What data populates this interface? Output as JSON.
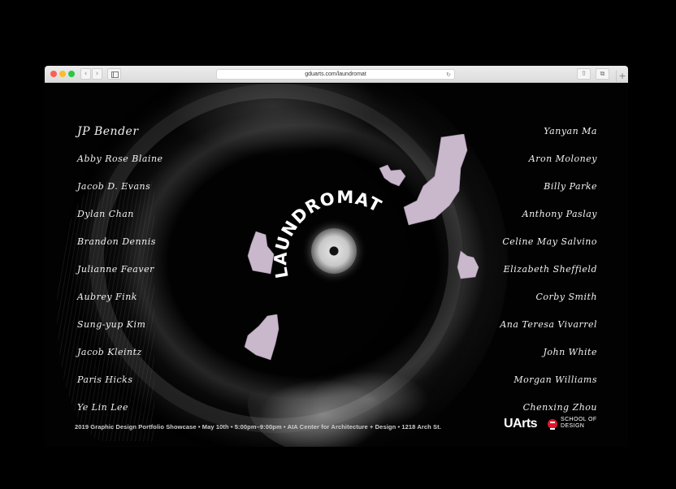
{
  "browser": {
    "url": "gduarts.com/laundromat",
    "icons": {
      "back": "chevron-left-icon",
      "forward": "chevron-right-icon",
      "sidebar": "sidebar-icon",
      "reload": "reload-icon",
      "share": "share-icon",
      "tabs": "tabs-icon",
      "new_tab": "plus-icon"
    },
    "glyphs": {
      "back": "‹",
      "forward": "›",
      "reload": "↻",
      "share": "⇧",
      "tabs": "⧉",
      "new_tab": "+"
    }
  },
  "page": {
    "title": "LAUNDROMAT",
    "names_left": [
      "JP Bender",
      "Abby Rose Blaine",
      "Jacob D. Evans",
      "Dylan Chan",
      "Brandon Dennis",
      "Julianne Feaver",
      "Aubrey Fink",
      "Sung-yup Kim",
      "Jacob Kleintz",
      "Paris Hicks",
      "Ye Lin Lee"
    ],
    "names_right": [
      "Yanyan Ma",
      "Aron Moloney",
      "Billy Parke",
      "Anthony Paslay",
      "Celine May Salvino",
      "Elizabeth Sheffield",
      "Corby Smith",
      "Ana Teresa Vivarrel",
      "John White",
      "Morgan Williams",
      "Chenxing Zhou"
    ],
    "footer_info": "2019 Graphic Design Portfolio Showcase • May 10th • 5:00pm–9:00pm • AIA Center for Architecture + Design • 1218 Arch St.",
    "logo": {
      "brand": "UArts",
      "line1": "SCHOOL OF",
      "line2": "DESIGN"
    }
  },
  "colors": {
    "background": "#000000",
    "scrap_fill": "#c9b7cc",
    "logo_red": "#e2152b"
  }
}
